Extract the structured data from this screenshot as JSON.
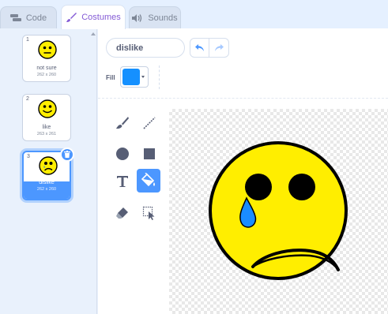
{
  "tabs": [
    {
      "label": "Code",
      "icon": "code-blocks-icon"
    },
    {
      "label": "Costumes",
      "icon": "brush-icon"
    },
    {
      "label": "Sounds",
      "icon": "speaker-icon"
    }
  ],
  "costumes": [
    {
      "number": "1",
      "name": "not sure",
      "size": "262 x 260",
      "face": "neutral"
    },
    {
      "number": "2",
      "name": "like",
      "size": "263 x 261",
      "face": "happy"
    },
    {
      "number": "3",
      "name": "dislike",
      "size": "262 x 260",
      "face": "sad",
      "selected": true
    }
  ],
  "editor": {
    "costume_name": "dislike",
    "fill_label": "Fill",
    "fill_color": "#1590ff"
  },
  "tools": [
    "brush-icon",
    "line-icon",
    "circle-icon",
    "rectangle-icon",
    "text-icon",
    "fill-bucket-icon",
    "eraser-icon",
    "select-icon"
  ],
  "active_tool": "fill-bucket-icon",
  "colors": {
    "accent": "#4c97ff",
    "tab_active_text": "#855cd6",
    "face_yellow": "#ffee00",
    "tear_blue": "#1a8cff"
  }
}
